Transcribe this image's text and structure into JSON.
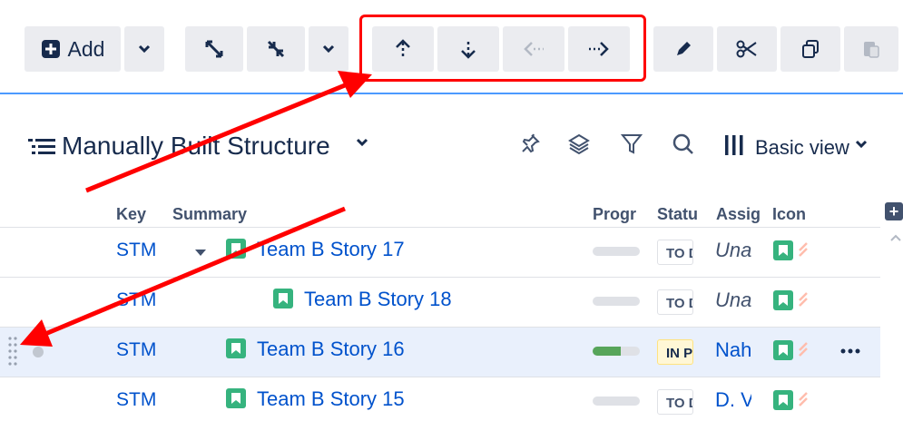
{
  "toolbar": {
    "add_label": "Add"
  },
  "structure": {
    "title": "Manually Built Structure",
    "view_label": "Basic view"
  },
  "columns": {
    "key": "Key",
    "summary": "Summary",
    "progress": "Progr",
    "status": "Statu",
    "assignee": "Assig",
    "icons": "Icon"
  },
  "rows": [
    {
      "key": "STM",
      "summary": "Team B Story 17",
      "progress": 0.0,
      "status": "TO DO",
      "assignee": "Unassigned"
    },
    {
      "key": "STM",
      "summary": "Team B Story 18",
      "progress": 0.0,
      "status": "TO DO",
      "assignee": "Unassigned"
    },
    {
      "key": "STM",
      "summary": "Team B Story 16",
      "progress": 0.6,
      "status": "IN PROGRESS",
      "assignee": "Nahla"
    },
    {
      "key": "STM",
      "summary": "Team B Story 15",
      "progress": 0.0,
      "status": "TO DO",
      "assignee": "D. V"
    }
  ],
  "colors": {
    "accent": "#0052cc",
    "story_green": "#36b37e",
    "highlight_red": "#ff0000",
    "selected_row": "#e9f0fc"
  },
  "icons": [
    "add-icon",
    "chevron-down-icon",
    "expand-icon",
    "collapse-icon",
    "move-up-icon",
    "move-down-icon",
    "outdent-icon",
    "indent-icon",
    "pencil-icon",
    "scissors-icon",
    "copy-icon",
    "paste-icon",
    "pin-icon",
    "layers-icon",
    "filter-icon",
    "search-icon",
    "columns-icon",
    "story-icon",
    "priority-icon",
    "more-icon",
    "drag-handle-icon"
  ]
}
